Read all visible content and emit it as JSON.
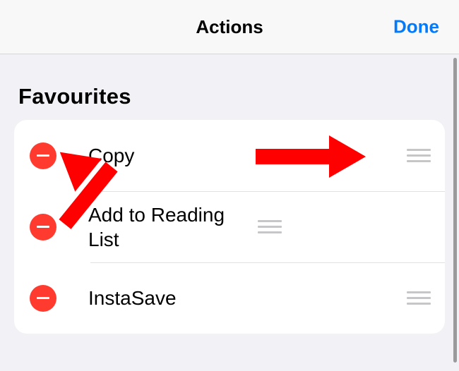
{
  "header": {
    "title": "Actions",
    "done_label": "Done"
  },
  "section": {
    "title": "Favourites"
  },
  "items": [
    {
      "label": "Copy"
    },
    {
      "label": "Add to Reading List"
    },
    {
      "label": "InstaSave"
    }
  ]
}
